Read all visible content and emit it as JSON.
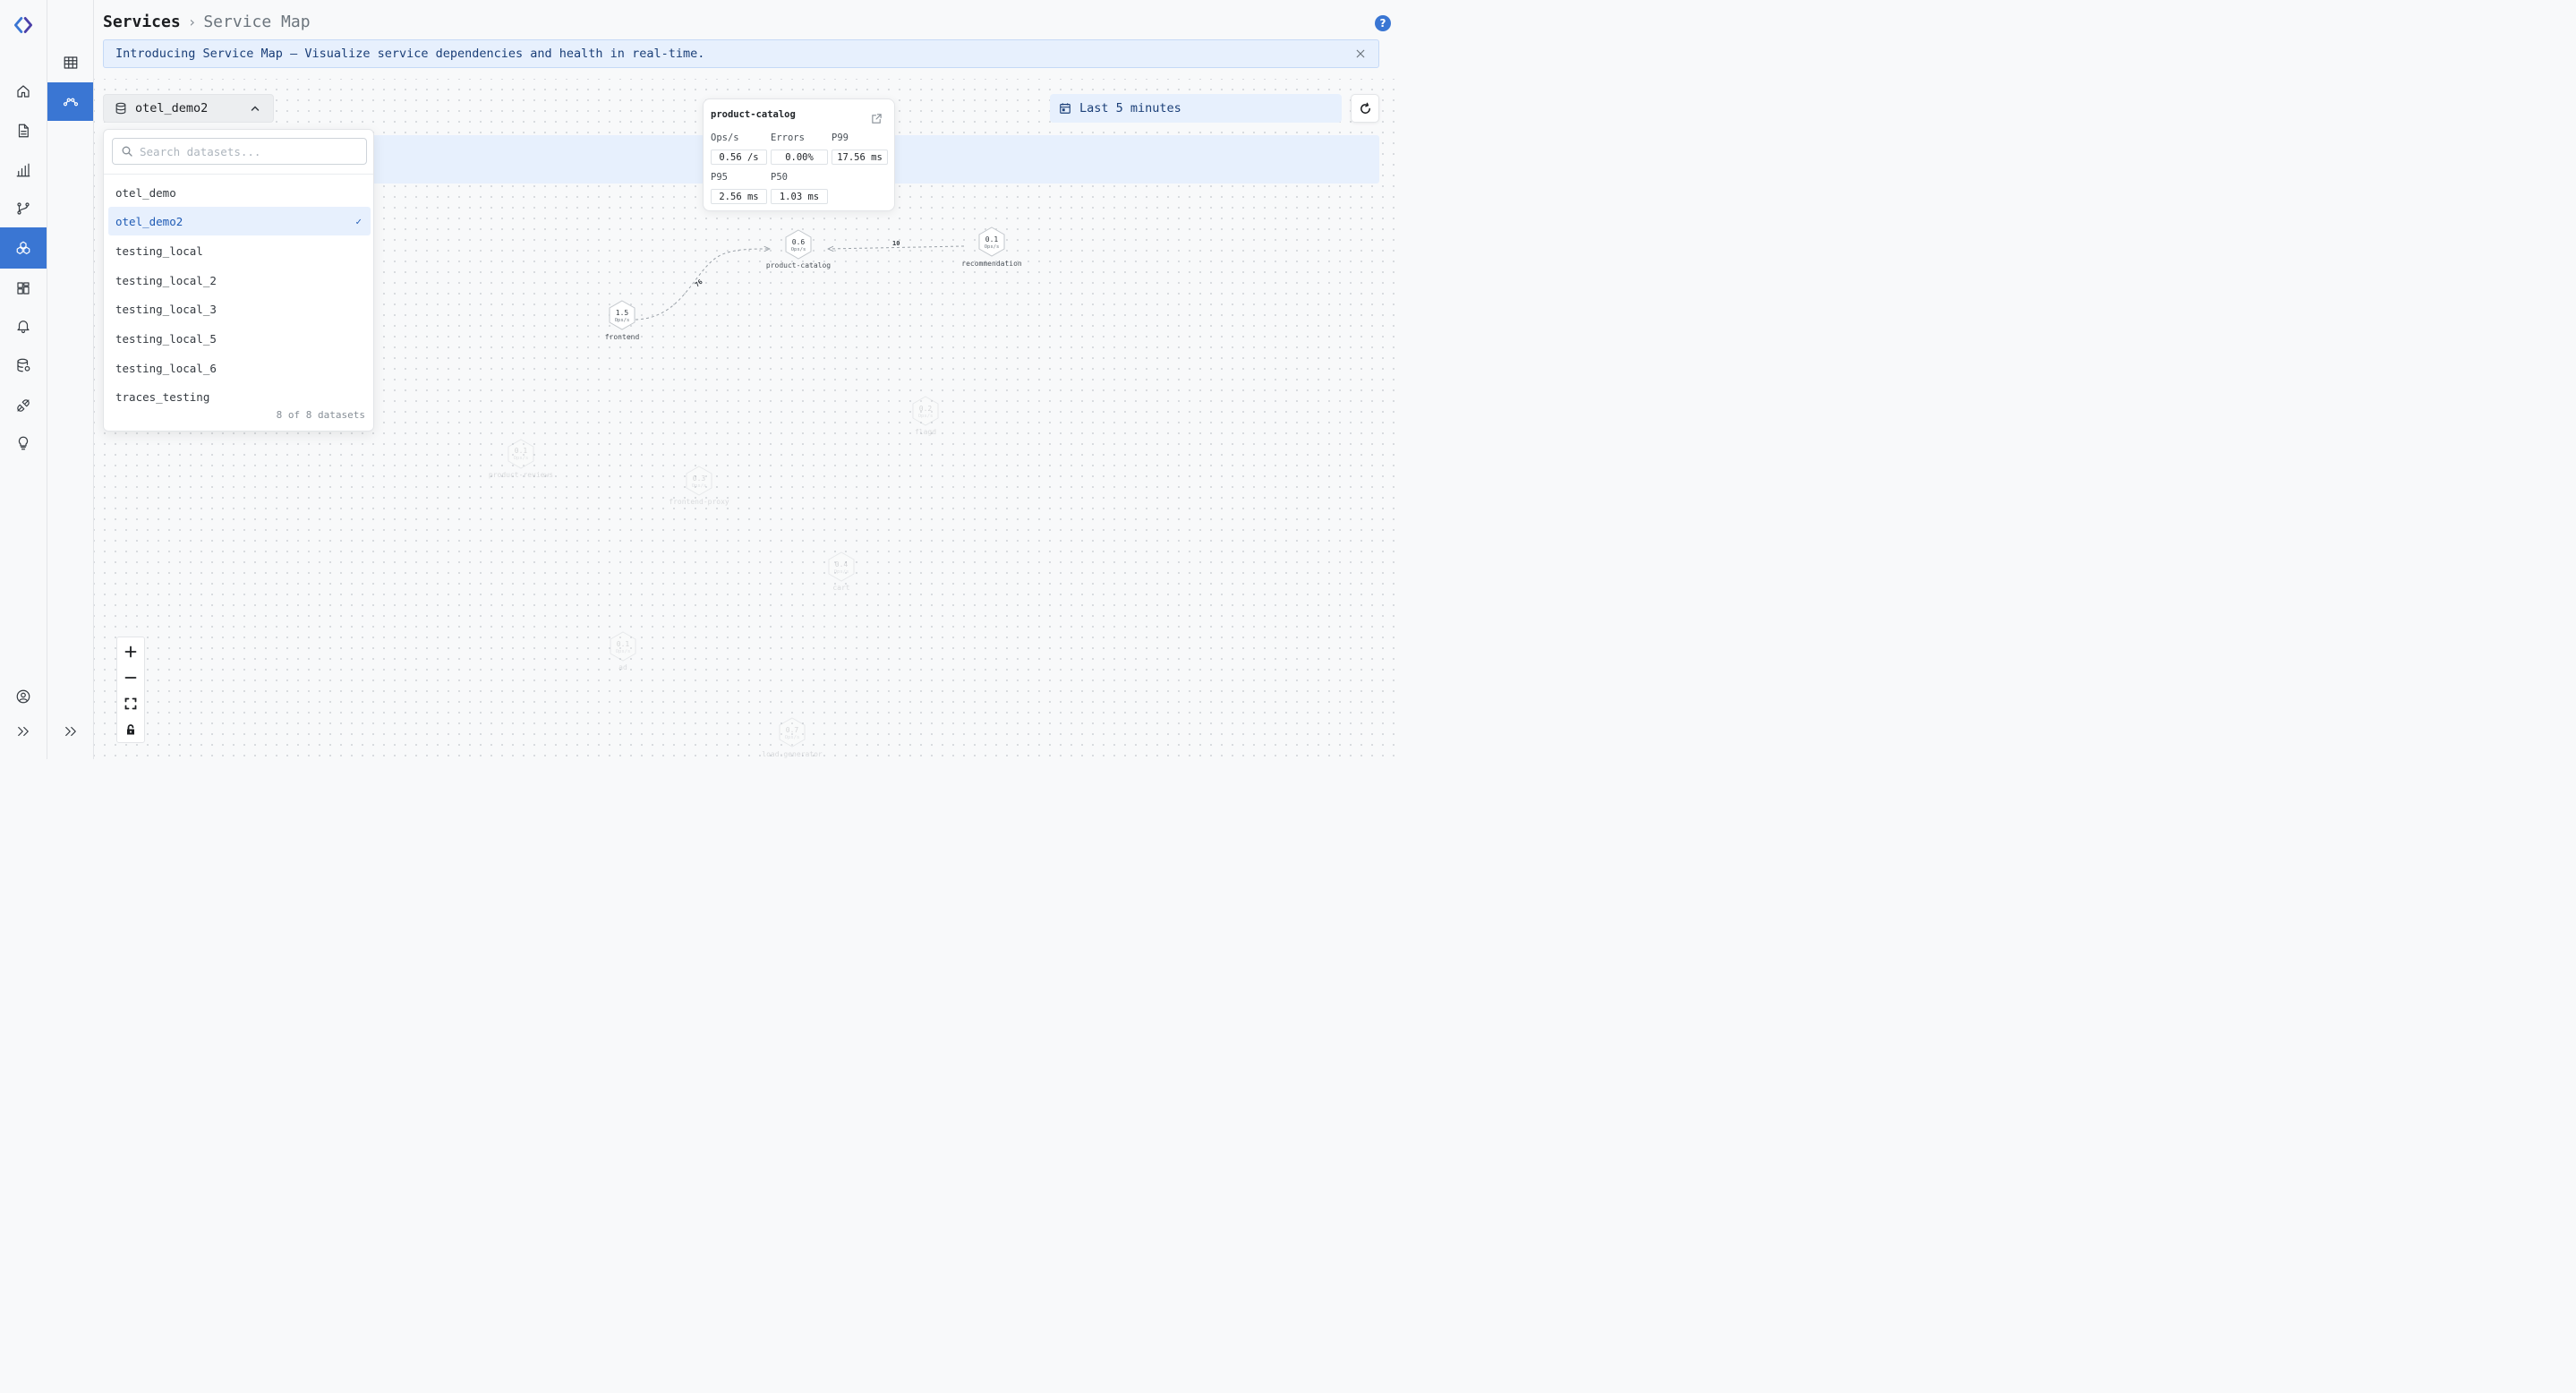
{
  "app": {
    "logo": "chevrons-logo-icon"
  },
  "rail": {
    "items": [
      {
        "name": "home-icon"
      },
      {
        "name": "document-icon"
      },
      {
        "name": "bar-chart-icon"
      },
      {
        "name": "git-branch-icon"
      },
      {
        "name": "services-icon",
        "active": true
      },
      {
        "name": "dashboard-icon"
      },
      {
        "name": "bell-icon"
      },
      {
        "name": "database-settings-icon"
      },
      {
        "name": "plug-icon"
      },
      {
        "name": "lightbulb-icon"
      }
    ],
    "bottom": [
      {
        "name": "user-circle-icon"
      },
      {
        "name": "expand-chevrons-icon"
      }
    ]
  },
  "subrail": {
    "items": [
      {
        "name": "table-icon"
      },
      {
        "name": "service-map-icon",
        "active": true
      }
    ],
    "bottom": [
      {
        "name": "expand-chevrons-icon"
      }
    ]
  },
  "breadcrumb": {
    "root": "Services",
    "current": "Service Map"
  },
  "banner": {
    "text": "Introducing Service Map – Visualize service dependencies and health in real-time."
  },
  "dataset": {
    "selected": "otel_demo2",
    "search_placeholder": "Search datasets...",
    "options": [
      "otel_demo",
      "otel_demo2",
      "testing_local",
      "testing_local_2",
      "testing_local_3",
      "testing_local_5",
      "testing_local_6",
      "traces_testing"
    ],
    "count_text": "8 of 8 datasets",
    "check_glyph": "✓"
  },
  "time_range": {
    "label": "Last 5 minutes"
  },
  "service_card": {
    "name": "product-catalog",
    "ops_label": "Ops/s",
    "ops_value": "0.56 /s",
    "errors_label": "Errors",
    "errors_value": "0.00%",
    "p99_label": "P99",
    "p99_value": "17.56 ms",
    "p95_label": "P95",
    "p95_value": "2.56 ms",
    "p50_label": "P50",
    "p50_value": "1.03 ms"
  },
  "nodes": [
    {
      "name": "frontend",
      "ops": "1.5",
      "unit": "Ops/s"
    },
    {
      "name": "product-catalog",
      "ops": "0.6",
      "unit": "Ops/s"
    },
    {
      "name": "recommendation",
      "ops": "0.1",
      "unit": "Ops/s"
    }
  ],
  "edges": [
    {
      "from": "frontend",
      "to": "product-catalog",
      "label": "76"
    },
    {
      "from": "recommendation",
      "to": "product-catalog",
      "label": "10"
    }
  ],
  "faded_nodes": [
    {
      "name": "product-reviews",
      "ops": "0.1"
    },
    {
      "name": "frontend-proxy",
      "ops": "0.3"
    },
    {
      "name": "flagd",
      "ops": "0.2"
    },
    {
      "name": "cart",
      "ops": "0.4"
    },
    {
      "name": "ad",
      "ops": "0.1"
    },
    {
      "name": "load-generator",
      "ops": "0.7"
    }
  ],
  "faded_unit": "Ops/s",
  "zoom": {
    "controls": [
      "zoom-in-icon",
      "zoom-out-icon",
      "fit-view-icon",
      "lock-icon"
    ]
  }
}
